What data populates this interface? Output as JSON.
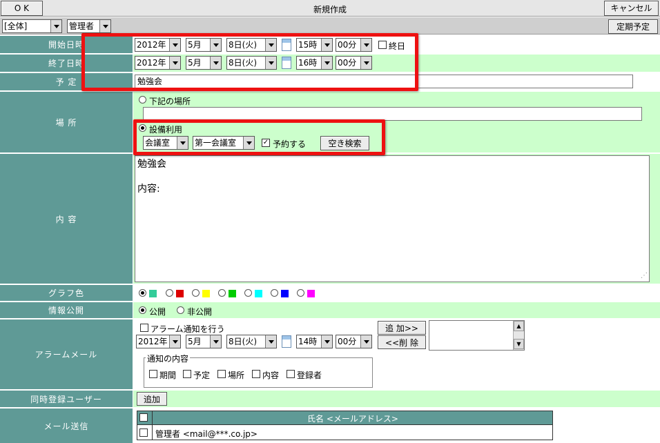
{
  "toolbar": {
    "ok": "O K",
    "title": "新規作成",
    "cancel": "キャンセル"
  },
  "filters": {
    "scope": "[全体]",
    "user": "管理者",
    "regular": "定期予定"
  },
  "labels": {
    "start": "開始日時",
    "end": "終了日時",
    "plan": "予 定",
    "place": "場 所",
    "content": "内 容",
    "graph_color": "グラフ色",
    "publish": "情報公開",
    "alarm_mail": "アラームメール",
    "co_users": "同時登録ユーザー",
    "mail_send": "メール送信"
  },
  "start": {
    "year": "2012年",
    "month": "5月",
    "day": "8日(火)",
    "hour": "15時",
    "minute": "00分",
    "allday": "終日"
  },
  "end": {
    "year": "2012年",
    "month": "5月",
    "day": "8日(火)",
    "hour": "16時",
    "minute": "00分"
  },
  "plan": {
    "value": "勉強会"
  },
  "place": {
    "option_text": "下記の場所",
    "option_text_checked": false,
    "text_value": "",
    "option_facility": "設備利用",
    "option_facility_checked": true,
    "category": "会議室",
    "room": "第一会議室",
    "reserve": "予約する",
    "reserve_checked": true,
    "search": "空き検索"
  },
  "content": {
    "line1": "勉強会",
    "line2": "",
    "line3": "内容:"
  },
  "graph_colors": [
    "#33cc99",
    "#dd0000",
    "#ffff00",
    "#00cc00",
    "#00ffff",
    "#0000ff",
    "#ff00ff"
  ],
  "publish": {
    "public": "公開",
    "private": "非公開",
    "selected": "public"
  },
  "alarm": {
    "notify": "アラーム通知を行う",
    "notify_checked": false,
    "year": "2012年",
    "month": "5月",
    "day": "8日(火)",
    "hour": "14時",
    "minute": "00分",
    "add": "追 加>>",
    "remove": "<<削 除",
    "group_title": "通知の内容",
    "items": [
      "期間",
      "予定",
      "場所",
      "内容",
      "登録者"
    ]
  },
  "co_users": {
    "add": "追加"
  },
  "mail": {
    "header": "氏名 <メールアドレス>",
    "rows": [
      {
        "text": "管理者 <mail@***.co.jp>"
      }
    ]
  },
  "annotation_color": "#ee1111",
  "row_bg": "#ccffcc",
  "label_bg": "#5f9a96"
}
